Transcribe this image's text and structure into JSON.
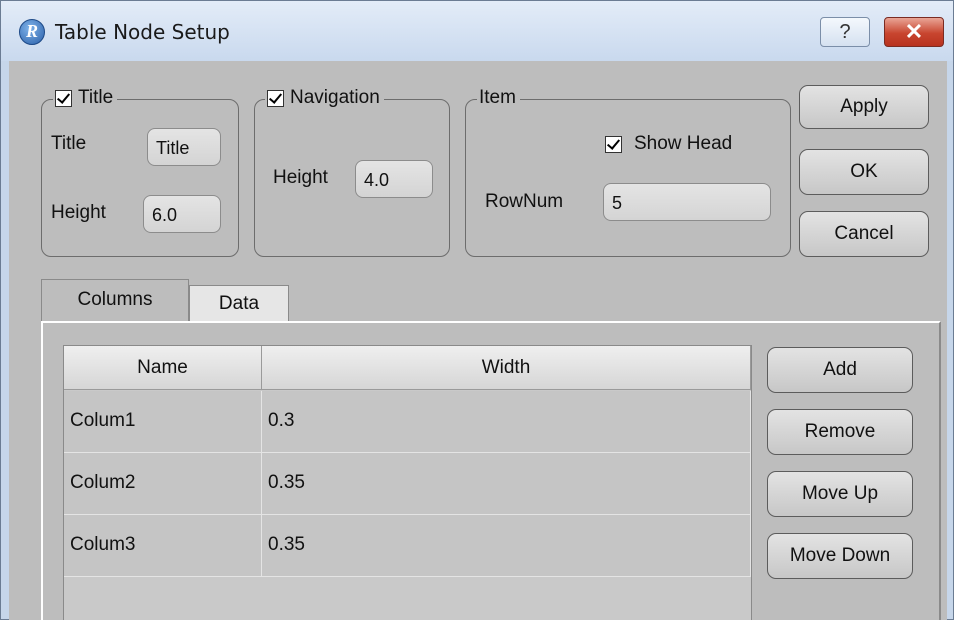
{
  "window": {
    "title": "Table Node Setup",
    "app_icon_letter": "R",
    "help_glyph": "?",
    "close_glyph": "✕"
  },
  "title_group": {
    "legend": "Title",
    "checked": true,
    "title_label": "Title",
    "title_value": "Title",
    "height_label": "Height",
    "height_value": "6.0"
  },
  "navigation_group": {
    "legend": "Navigation",
    "checked": true,
    "height_label": "Height",
    "height_value": "4.0"
  },
  "item_group": {
    "legend": "Item",
    "show_head_label": "Show Head",
    "show_head_checked": true,
    "rownum_label": "RowNum",
    "rownum_value": "5"
  },
  "dialog_buttons": {
    "apply": "Apply",
    "ok": "OK",
    "cancel": "Cancel"
  },
  "tabs": [
    {
      "label": "Columns",
      "active": true
    },
    {
      "label": "Data",
      "active": false
    }
  ],
  "columns_table": {
    "headers": [
      "Name",
      "Width"
    ],
    "rows": [
      [
        "Colum1",
        "0.3"
      ],
      [
        "Colum2",
        "0.35"
      ],
      [
        "Colum3",
        "0.35"
      ]
    ]
  },
  "column_buttons": {
    "add": "Add",
    "remove": "Remove",
    "move_up": "Move Up",
    "move_down": "Move Down"
  }
}
